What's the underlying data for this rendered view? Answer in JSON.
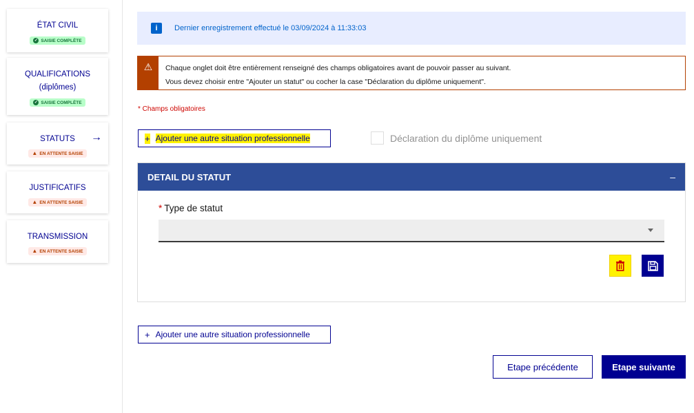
{
  "sidebar": {
    "steps": [
      {
        "title": "ÉTAT CIVIL",
        "status": "SAISIE COMPLÈTE"
      },
      {
        "title": "QUALIFICATIONS",
        "subtitle": "(diplômes)",
        "status": "SAISIE COMPLÈTE"
      },
      {
        "title": "STATUTS",
        "status": "EN ATTENTE SAISIE",
        "current_arrow": "→"
      },
      {
        "title": "JUSTIFICATIFS",
        "status": "EN ATTENTE SAISIE"
      },
      {
        "title": "TRANSMISSION",
        "status": "EN ATTENTE SAISIE"
      }
    ]
  },
  "info": {
    "icon": "i",
    "text": "Dernier enregistrement effectué le 03/09/2024 à 11:33:03"
  },
  "warning": {
    "icon": "⚠",
    "line1": "Chaque onglet doit être entièrement renseigné des champs obligatoires avant de pouvoir passer au suivant.",
    "line2": "Vous devez choisir entre \"Ajouter un statut\" ou cocher la case \"Déclaration du diplôme uniquement\"."
  },
  "required_note": "* Champs obligatoires",
  "add_situation_top": {
    "plus": "+",
    "label": "Ajouter une autre situation professionnelle"
  },
  "checkbox_label": "Déclaration du diplôme uniquement",
  "panel": {
    "title": "DETAIL DU STATUT",
    "collapse": "–",
    "field_required_mark": "*",
    "field_label": "Type de statut",
    "select_value": ""
  },
  "add_situation_bottom": {
    "plus": "+",
    "label": "Ajouter une autre situation professionnelle"
  },
  "footer": {
    "prev_label": "Etape précédente",
    "next_label": "Etape suivante"
  },
  "colors": {
    "primary": "#000091",
    "panel_header": "#2d4d98",
    "warning": "#b34000",
    "success": "#18753c",
    "info": "#0063cb",
    "highlight": "#fff200"
  }
}
